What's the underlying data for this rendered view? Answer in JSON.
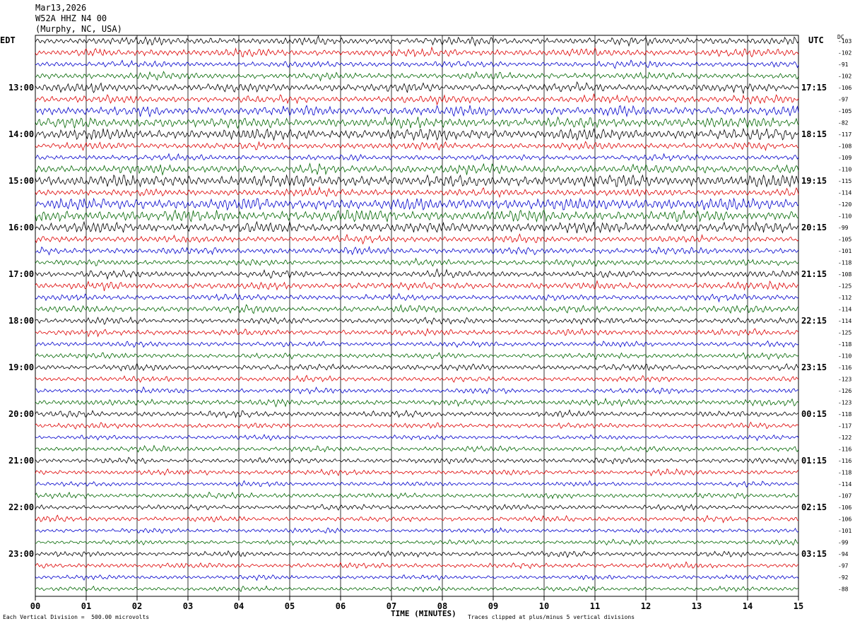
{
  "header": {
    "date": "Mar13,2026",
    "station": "W52A HHZ N4 00",
    "location": "(Murphy, NC, USA)",
    "left_tz": "EDT",
    "right_tz": "UTC",
    "dc_label": "DC"
  },
  "footer": {
    "scale_note": "Each Vertical Division =  500.00 microvolts",
    "clip_note": "Traces clipped at plus/minus 5 vertical divisions",
    "xlabel": "TIME (MINUTES)"
  },
  "colors": {
    "trace_cycle": [
      "#000000",
      "#dd0000",
      "#0000cc",
      "#006600"
    ],
    "grid": "#000000"
  },
  "chart_data": {
    "type": "line",
    "xlabel": "TIME (MINUTES)",
    "xlim": [
      0,
      15
    ],
    "x_ticks": [
      "00",
      "01",
      "02",
      "03",
      "04",
      "05",
      "06",
      "07",
      "08",
      "09",
      "10",
      "11",
      "12",
      "13",
      "14",
      "15"
    ],
    "rows": 48,
    "row_minutes": 15,
    "left_hour_labels": [
      "13:00",
      "14:00",
      "15:00",
      "16:00",
      "17:00",
      "18:00",
      "19:00",
      "20:00",
      "21:00",
      "22:00",
      "23:00"
    ],
    "right_hour_labels": [
      "17:15",
      "18:15",
      "19:15",
      "20:15",
      "21:15",
      "22:15",
      "23:15",
      "00:15",
      "01:15",
      "02:15",
      "03:15"
    ],
    "dc_offsets": [
      "-103",
      "-102",
      "-91",
      "-102",
      "-106",
      "-97",
      "-105",
      "-82",
      "-117",
      "-108",
      "-109",
      "-110",
      "-115",
      "-114",
      "-120",
      "-110",
      "-99",
      "-105",
      "-101",
      "-118",
      "-108",
      "-125",
      "-112",
      "-114",
      "-114",
      "-125",
      "-118",
      "-110",
      "-116",
      "-123",
      "-126",
      "-123",
      "-118",
      "-117",
      "-122",
      "-116",
      "-116",
      "-118",
      "-114",
      "-107",
      "-106",
      "-106",
      "-101",
      "-99",
      "-94",
      "-97",
      "-92",
      "-88"
    ],
    "amplitude": [
      1.0,
      1.0,
      0.8,
      0.9,
      1.1,
      1.0,
      1.3,
      1.4,
      1.5,
      0.9,
      0.8,
      1.2,
      1.6,
      1.0,
      1.6,
      1.5,
      1.4,
      0.9,
      0.9,
      0.8,
      0.9,
      1.0,
      0.8,
      0.9,
      0.8,
      0.8,
      0.7,
      0.7,
      0.8,
      0.7,
      0.7,
      0.8,
      0.8,
      0.7,
      0.6,
      0.7,
      0.7,
      0.7,
      0.6,
      0.7,
      0.7,
      0.7,
      0.6,
      0.6,
      0.7,
      0.7,
      0.6,
      0.6
    ]
  }
}
